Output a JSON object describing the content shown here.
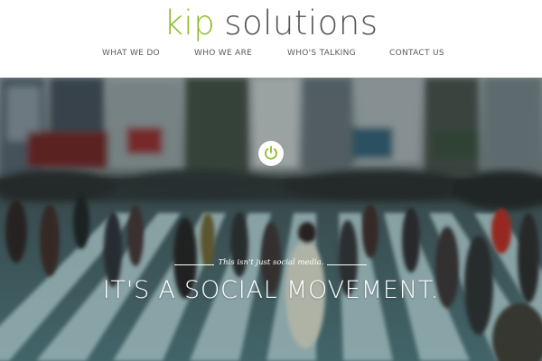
{
  "header": {
    "logo": {
      "brand": "kip",
      "rest": "solutions"
    },
    "nav": [
      {
        "label": "WHAT WE DO"
      },
      {
        "label": "WHO WE ARE"
      },
      {
        "label": "WHO'S TALKING"
      },
      {
        "label": "CONTACT US"
      }
    ]
  },
  "hero": {
    "tagline": "This isn't just social media.",
    "headline": "IT'S A SOCIAL MOVEMENT."
  },
  "icons": {
    "power_button": "power-icon"
  },
  "colors": {
    "brand_green": "#8cbb2a",
    "logo_gray": "#555555",
    "nav_gray": "#5a5a5a",
    "hero_text": "#ffffff"
  }
}
